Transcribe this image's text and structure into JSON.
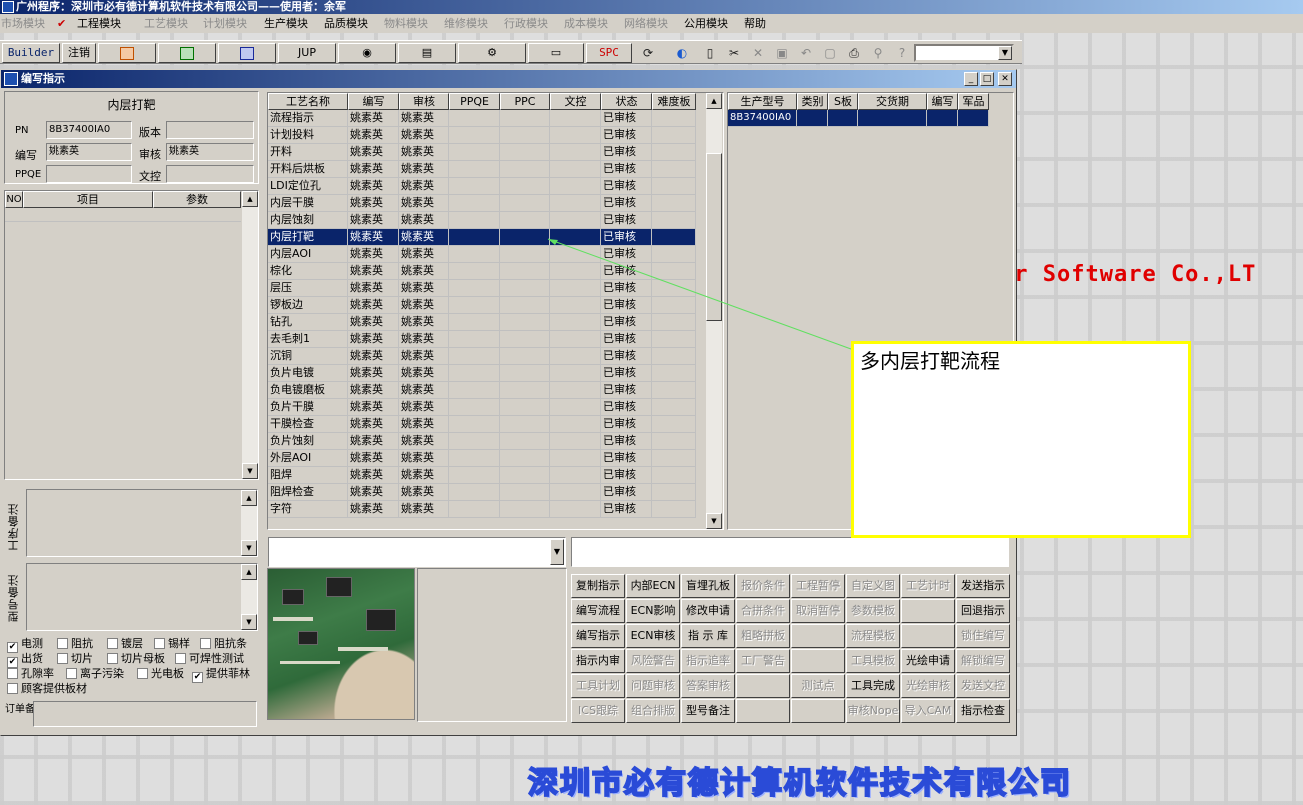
{
  "window": {
    "title": "广州程序：深圳市必有德计算机软件技术有限公司——使用者：余军"
  },
  "menu": [
    {
      "label": "市场模块",
      "enabled": false
    },
    {
      "label": "工程模块",
      "enabled": true,
      "checked": true
    },
    {
      "label": "工艺模块",
      "enabled": false
    },
    {
      "label": "计划模块",
      "enabled": false
    },
    {
      "label": "生产模块",
      "enabled": true
    },
    {
      "label": "品质模块",
      "enabled": true
    },
    {
      "label": "物料模块",
      "enabled": false
    },
    {
      "label": "维修模块",
      "enabled": false
    },
    {
      "label": "行政模块",
      "enabled": false
    },
    {
      "label": "成本模块",
      "enabled": false
    },
    {
      "label": "网络模块",
      "enabled": false
    },
    {
      "label": "公用模块",
      "enabled": true
    },
    {
      "label": "帮助",
      "enabled": true
    }
  ],
  "toolbar": {
    "builder_label": "Builder",
    "logout_label": "注销",
    "jup_label": "JUP",
    "spc_label": "SPC",
    "combo_value": ""
  },
  "child_window": {
    "title": "编写指示"
  },
  "left_panel": {
    "heading": "内层打靶",
    "pn_label": "PN",
    "pn_value": "8B37400IA0",
    "version_label": "版本",
    "version_value": "",
    "writer_label": "编写",
    "writer_value": "姚素英",
    "reviewer_label": "审核",
    "reviewer_value": "姚素英",
    "ppqe_label": "PPQE",
    "ppqe_value": "",
    "doc_label": "文控",
    "doc_value": "",
    "param_headers": [
      "NO",
      "项目",
      "参数"
    ],
    "process_note_label": "工序备注",
    "model_note_label": "型号备注",
    "order_note_label": "订单备注",
    "order_note_value": ""
  },
  "checkboxes": [
    {
      "label": "电测",
      "checked": true
    },
    {
      "label": "阻抗",
      "checked": false
    },
    {
      "label": "镀层",
      "checked": false
    },
    {
      "label": "锡样",
      "checked": false
    },
    {
      "label": "阻抗条",
      "checked": false
    },
    {
      "label": "出货",
      "checked": true
    },
    {
      "label": "切片",
      "checked": false
    },
    {
      "label": "切片母板",
      "checked": false
    },
    {
      "label": "可焊性测试",
      "checked": false
    },
    {
      "label": "孔隙率",
      "checked": false
    },
    {
      "label": "离子污染",
      "checked": false
    },
    {
      "label": "光电板",
      "checked": false
    },
    {
      "label": "提供菲林",
      "checked": true
    },
    {
      "label": "顾客提供板材",
      "checked": false
    }
  ],
  "process_table": {
    "headers": [
      "工艺名称",
      "编写",
      "审核",
      "PPQE",
      "PPC",
      "文控",
      "状态",
      "难度板"
    ],
    "selected_index": 7,
    "rows": [
      [
        "流程指示",
        "姚素英",
        "姚素英",
        "",
        "",
        "",
        "已审核",
        ""
      ],
      [
        "计划投料",
        "姚素英",
        "姚素英",
        "",
        "",
        "",
        "已审核",
        ""
      ],
      [
        "开料",
        "姚素英",
        "姚素英",
        "",
        "",
        "",
        "已审核",
        ""
      ],
      [
        "开料后烘板",
        "姚素英",
        "姚素英",
        "",
        "",
        "",
        "已审核",
        ""
      ],
      [
        "LDI定位孔",
        "姚素英",
        "姚素英",
        "",
        "",
        "",
        "已审核",
        ""
      ],
      [
        "内层干膜",
        "姚素英",
        "姚素英",
        "",
        "",
        "",
        "已审核",
        ""
      ],
      [
        "内层蚀刻",
        "姚素英",
        "姚素英",
        "",
        "",
        "",
        "已审核",
        ""
      ],
      [
        "内层打靶",
        "姚素英",
        "姚素英",
        "",
        "",
        "",
        "已审核",
        ""
      ],
      [
        "内层AOI",
        "姚素英",
        "姚素英",
        "",
        "",
        "",
        "已审核",
        ""
      ],
      [
        "棕化",
        "姚素英",
        "姚素英",
        "",
        "",
        "",
        "已审核",
        ""
      ],
      [
        "层压",
        "姚素英",
        "姚素英",
        "",
        "",
        "",
        "已审核",
        ""
      ],
      [
        "锣板边",
        "姚素英",
        "姚素英",
        "",
        "",
        "",
        "已审核",
        ""
      ],
      [
        "钻孔",
        "姚素英",
        "姚素英",
        "",
        "",
        "",
        "已审核",
        ""
      ],
      [
        "去毛刺1",
        "姚素英",
        "姚素英",
        "",
        "",
        "",
        "已审核",
        ""
      ],
      [
        "沉铜",
        "姚素英",
        "姚素英",
        "",
        "",
        "",
        "已审核",
        ""
      ],
      [
        "负片电镀",
        "姚素英",
        "姚素英",
        "",
        "",
        "",
        "已审核",
        ""
      ],
      [
        "负电镀磨板",
        "姚素英",
        "姚素英",
        "",
        "",
        "",
        "已审核",
        ""
      ],
      [
        "负片干膜",
        "姚素英",
        "姚素英",
        "",
        "",
        "",
        "已审核",
        ""
      ],
      [
        "干膜检查",
        "姚素英",
        "姚素英",
        "",
        "",
        "",
        "已审核",
        ""
      ],
      [
        "负片蚀刻",
        "姚素英",
        "姚素英",
        "",
        "",
        "",
        "已审核",
        ""
      ],
      [
        "外层AOI",
        "姚素英",
        "姚素英",
        "",
        "",
        "",
        "已审核",
        ""
      ],
      [
        "阻焊",
        "姚素英",
        "姚素英",
        "",
        "",
        "",
        "已审核",
        ""
      ],
      [
        "阻焊检查",
        "姚素英",
        "姚素英",
        "",
        "",
        "",
        "已审核",
        ""
      ],
      [
        "字符",
        "姚素英",
        "姚素英",
        "",
        "",
        "",
        "已审核",
        ""
      ]
    ]
  },
  "model_table": {
    "headers": [
      "生产型号",
      "类别",
      "S板",
      "交货期",
      "编写",
      "军品"
    ],
    "rows": [
      [
        "8B37400IA0",
        "",
        "",
        "",
        "",
        ""
      ]
    ]
  },
  "action_buttons": [
    {
      "label": "复制指示",
      "enabled": true
    },
    {
      "label": "内部ECN",
      "enabled": true
    },
    {
      "label": "盲埋孔板",
      "enabled": true
    },
    {
      "label": "报价条件",
      "enabled": false
    },
    {
      "label": "工程暂停",
      "enabled": false
    },
    {
      "label": "自定义图",
      "enabled": false
    },
    {
      "label": "工艺计时",
      "enabled": false
    },
    {
      "label": "发送指示",
      "enabled": true
    },
    {
      "label": "编写流程",
      "enabled": true
    },
    {
      "label": "ECN影响",
      "enabled": true
    },
    {
      "label": "修改申请",
      "enabled": true
    },
    {
      "label": "合拼条件",
      "enabled": false
    },
    {
      "label": "取消暂停",
      "enabled": false
    },
    {
      "label": "参数模板",
      "enabled": false
    },
    {
      "label": "",
      "enabled": false
    },
    {
      "label": "回退指示",
      "enabled": true
    },
    {
      "label": "编写指示",
      "enabled": true
    },
    {
      "label": "ECN审核",
      "enabled": true
    },
    {
      "label": "指 示 库",
      "enabled": true
    },
    {
      "label": "粗略拼板",
      "enabled": false
    },
    {
      "label": "",
      "enabled": false
    },
    {
      "label": "流程模板",
      "enabled": false
    },
    {
      "label": "",
      "enabled": false
    },
    {
      "label": "锁住编写",
      "enabled": false
    },
    {
      "label": "指示内审",
      "enabled": true
    },
    {
      "label": "风险警告",
      "enabled": false
    },
    {
      "label": "指示追率",
      "enabled": false
    },
    {
      "label": "工厂警告",
      "enabled": false
    },
    {
      "label": "",
      "enabled": false
    },
    {
      "label": "工具模板",
      "enabled": false
    },
    {
      "label": "光绘申请",
      "enabled": true
    },
    {
      "label": "解锁编写",
      "enabled": false
    },
    {
      "label": "工具计划",
      "enabled": false
    },
    {
      "label": "问题审核",
      "enabled": false
    },
    {
      "label": "答案审核",
      "enabled": false
    },
    {
      "label": "",
      "enabled": false
    },
    {
      "label": "测试点",
      "enabled": false
    },
    {
      "label": "工具完成",
      "enabled": true
    },
    {
      "label": "光绘审核",
      "enabled": false
    },
    {
      "label": "发送文控",
      "enabled": false
    },
    {
      "label": "ICS跟踪",
      "enabled": false
    },
    {
      "label": "组合排版",
      "enabled": false
    },
    {
      "label": "型号备注",
      "enabled": true
    },
    {
      "label": "",
      "enabled": false
    },
    {
      "label": "",
      "enabled": false
    },
    {
      "label": "审核Nope",
      "enabled": false
    },
    {
      "label": "导入CAM",
      "enabled": false
    },
    {
      "label": "指示检查",
      "enabled": true
    }
  ],
  "callout": {
    "text": "多内层打靶流程"
  },
  "background": {
    "english_text": "er Software Co.,LT",
    "company_text": "深圳市必有德计算机软件技术有限公司"
  },
  "colors": {
    "selection": "#0a246a",
    "callout_border": "#ffff00",
    "english_text": "#e00000",
    "company_text": "#2a4bd7"
  }
}
